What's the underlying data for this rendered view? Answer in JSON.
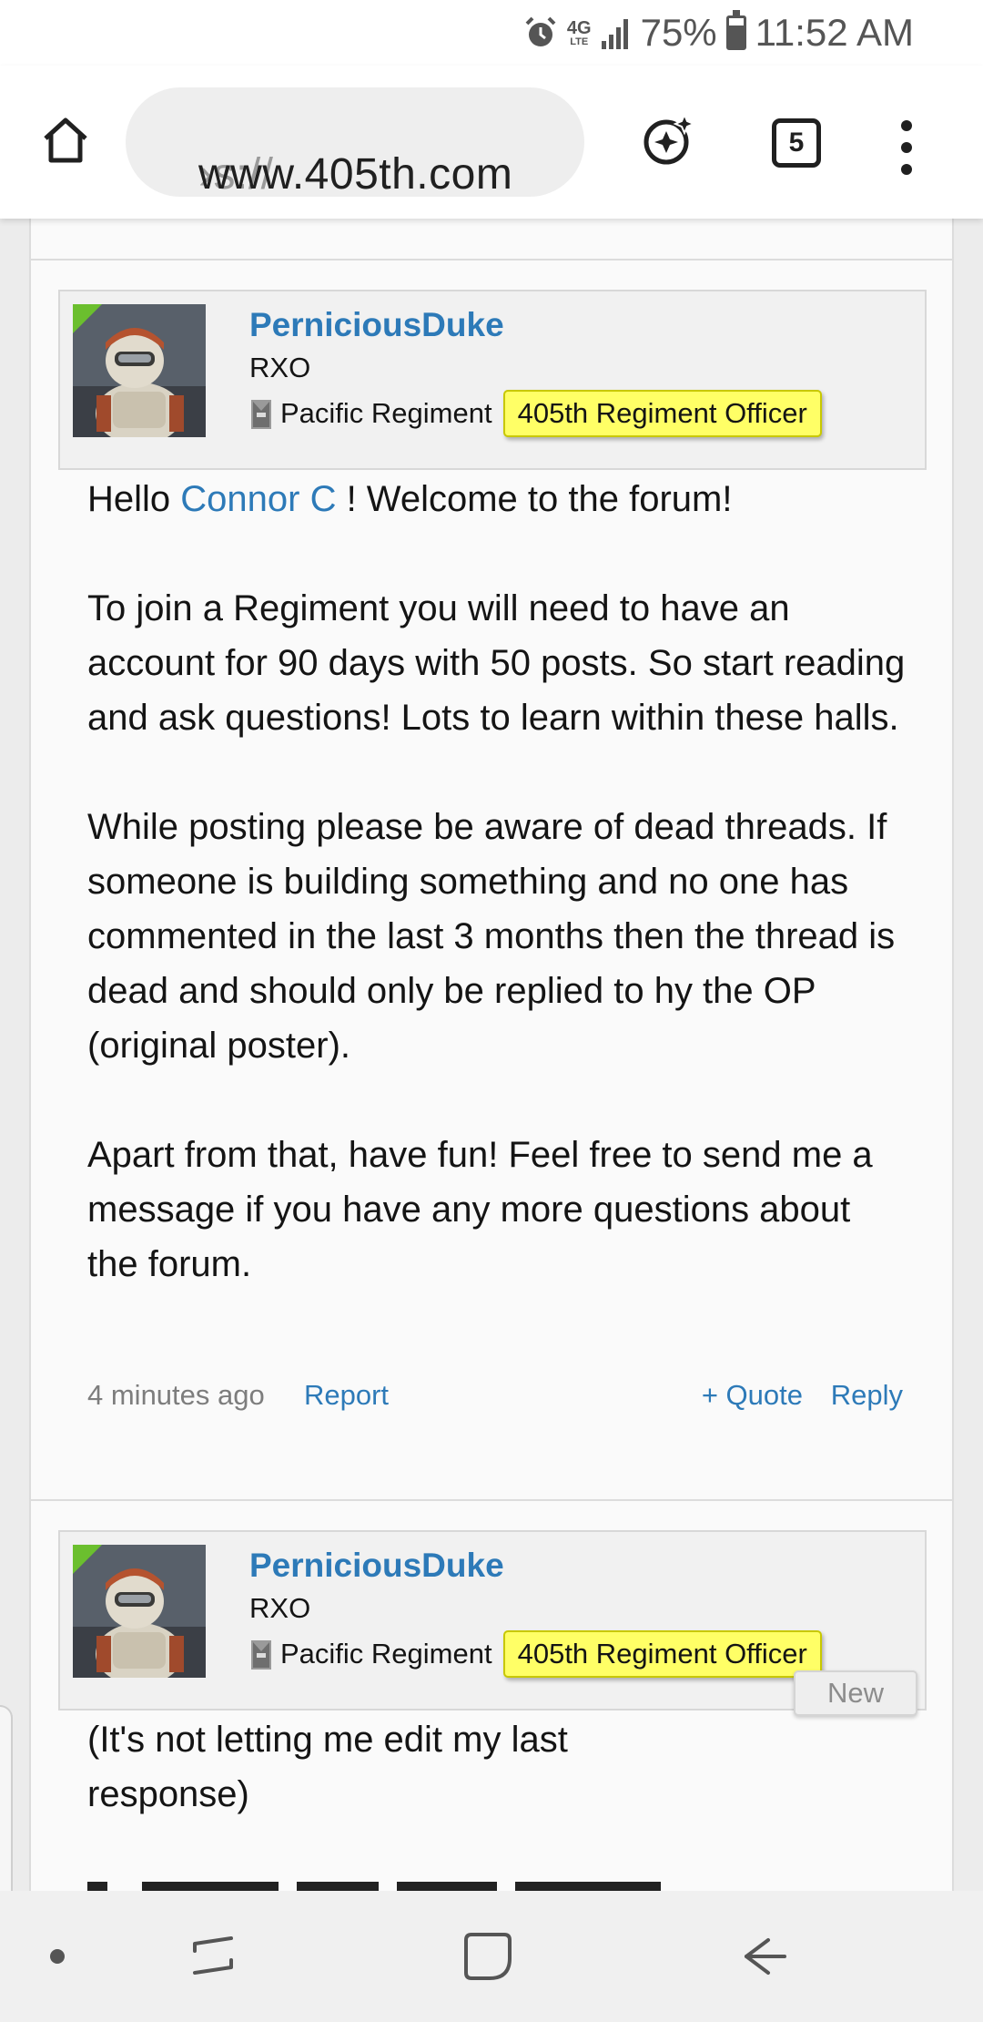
{
  "status_bar": {
    "network": "4G",
    "network_sub": "LTE",
    "battery_percent": "75%",
    "battery_level": 0.75,
    "time": "11:52 AM",
    "icons": [
      "alarm-icon",
      "network-4g-icon",
      "signal-icon",
      "battery-icon"
    ]
  },
  "browser": {
    "url_prefix": "›s://",
    "url_host": "www.405th.com",
    "tab_count": "5",
    "icons": [
      "home-icon",
      "sparkle-icon",
      "tabs-icon",
      "menu-icon"
    ]
  },
  "posts": [
    {
      "username": "PerniciousDuke",
      "user_title": "RXO",
      "regiment": "Pacific Regiment",
      "badge": "405th Regiment Officer",
      "message": {
        "p1_before": "Hello ",
        "p1_mention": "Connor C",
        "p1_after": " ! Welcome to the forum!",
        "p2": "To join a Regiment you will need to have an account for 90 days with 50 posts. So start reading and ask questions! Lots to learn within these halls.",
        "p3": "While posting please be aware of dead threads. If someone is building something and no one has commented in the last 3 months then the thread is dead and should only be replied to hy the OP (original poster).",
        "p4": "Apart from that, have fun! Feel free to send me a message if you have any more questions about the forum."
      },
      "time_ago": "4 minutes ago",
      "report_label": "Report",
      "quote_label": "+ Quote",
      "reply_label": "Reply"
    },
    {
      "username": "PerniciousDuke",
      "user_title": "RXO",
      "regiment": "Pacific Regiment",
      "badge": "405th Regiment Officer",
      "new_label": "New",
      "message": {
        "p1": "(It's not letting me edit my last response)"
      }
    }
  ],
  "colors": {
    "link": "#2d7ab8",
    "badge_bg": "#ffff66",
    "online_indicator": "#6bbf2e"
  },
  "nav_bar": {
    "icons": [
      "nav-dot-icon",
      "recents-icon",
      "home-square-icon",
      "back-icon"
    ]
  }
}
